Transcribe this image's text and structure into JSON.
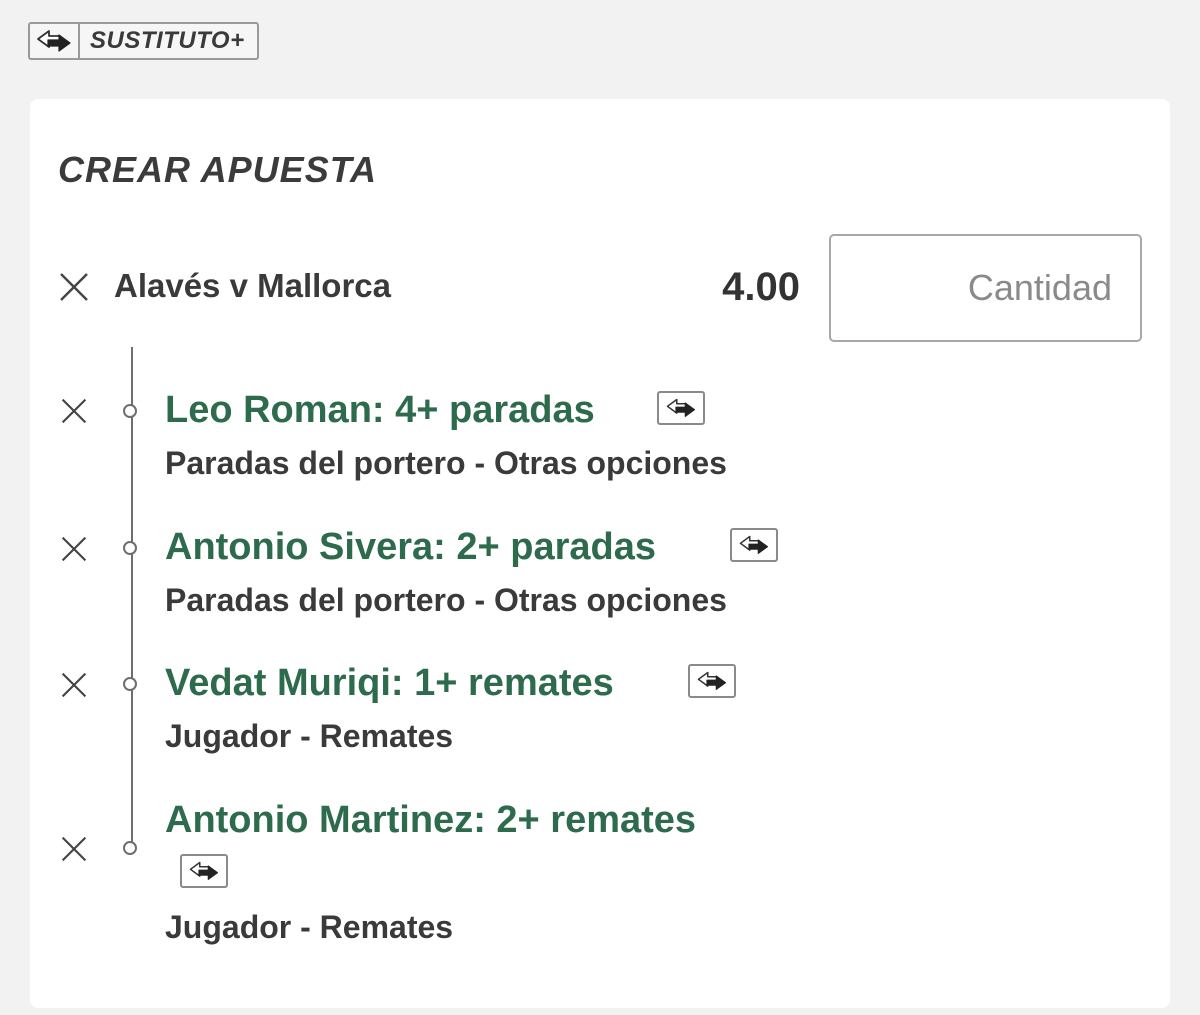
{
  "badge": {
    "label": "SUSTITUTO+",
    "icon": "swap-icon"
  },
  "card": {
    "title": "CREAR APUESTA",
    "event": {
      "name": "Alavés v Mallorca",
      "odds": "4.00",
      "stake_placeholder": "Cantidad",
      "remove_icon": "close-icon"
    },
    "selections": [
      {
        "title": "Leo Roman: 4+ paradas",
        "market": "Paradas del portero - Otras opciones",
        "icon": "swap-icon"
      },
      {
        "title": "Antonio Sivera: 2+ paradas",
        "market": "Paradas del portero - Otras opciones",
        "icon": "swap-icon"
      },
      {
        "title": "Vedat Muriqi: 1+ remates",
        "market": "Jugador - Remates",
        "icon": "swap-icon"
      },
      {
        "title": "Antonio Martinez: 2+ remates",
        "market": "Jugador - Remates",
        "icon": "swap-icon"
      }
    ]
  },
  "colors": {
    "selection_green": "#2e6b4d",
    "text_dark": "#3a3a3a",
    "background": "#f2f2f2"
  }
}
